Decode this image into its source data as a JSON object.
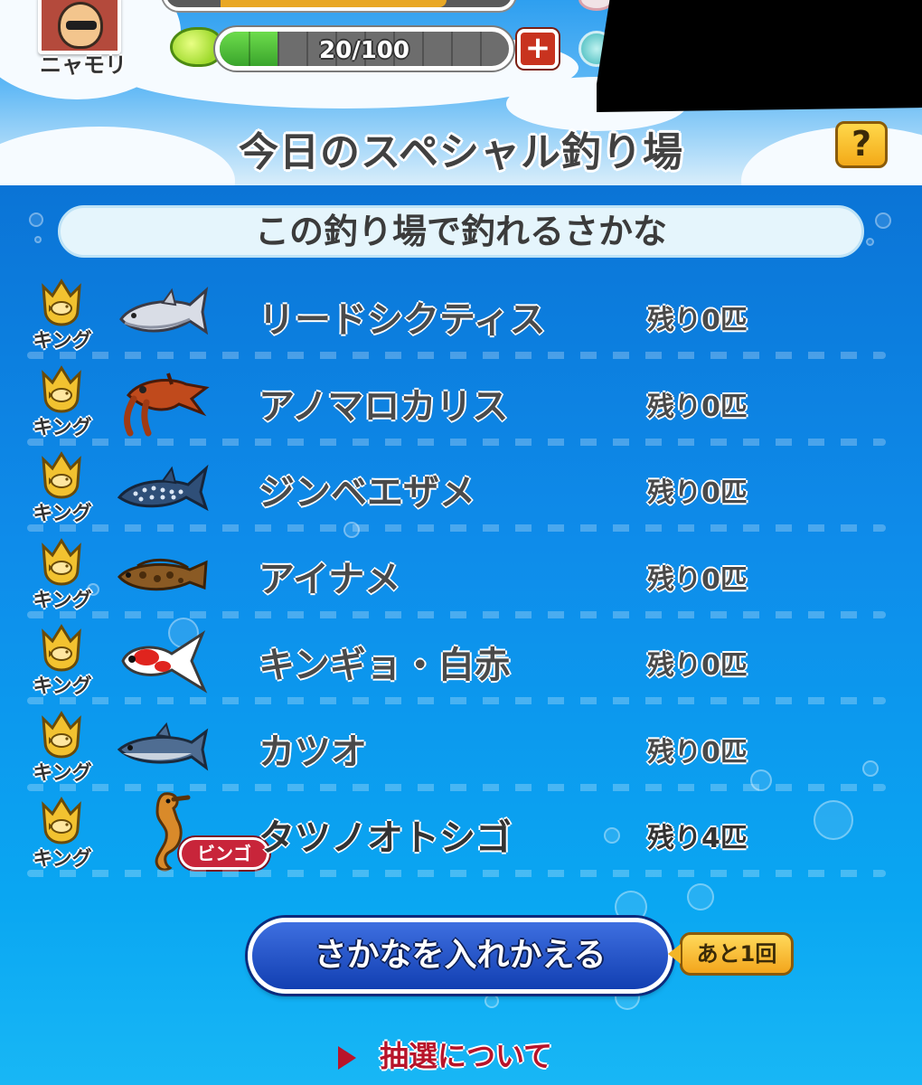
{
  "player": {
    "name": "ニャモリ"
  },
  "stamina": {
    "value": 20,
    "max": 100,
    "label": "20/100"
  },
  "page_title": "今日のスペシャル釣り場",
  "help_label": "?",
  "section_header": "この釣り場で釣れるさかな",
  "fish": [
    {
      "name": "リードシクティス",
      "remaining": "残り0匹",
      "badge": "キング",
      "icon": "leedsichthys-icon",
      "bingo": false
    },
    {
      "name": "アノマロカリス",
      "remaining": "残り0匹",
      "badge": "キング",
      "icon": "anomalocaris-icon",
      "bingo": false
    },
    {
      "name": "ジンベエザメ",
      "remaining": "残り0匹",
      "badge": "キング",
      "icon": "whale-shark-icon",
      "bingo": false
    },
    {
      "name": "アイナメ",
      "remaining": "残り0匹",
      "badge": "キング",
      "icon": "greenling-icon",
      "bingo": false
    },
    {
      "name": "キンギョ・白赤",
      "remaining": "残り0匹",
      "badge": "キング",
      "icon": "goldfish-icon",
      "bingo": false
    },
    {
      "name": "カツオ",
      "remaining": "残り0匹",
      "badge": "キング",
      "icon": "bonito-icon",
      "bingo": false
    },
    {
      "name": "タツノオトシゴ",
      "remaining": "残り4匹",
      "badge": "キング",
      "icon": "seahorse-icon",
      "bingo": true
    }
  ],
  "bingo_label": "ビンゴ",
  "swap_button_label": "さかなを入れかえる",
  "swap_remaining_label": "あと1回",
  "lottery_link_label": "抽選について",
  "colors": {
    "water": "#0a8fe3",
    "crown_gold": "#f2c230",
    "bingo_red": "#c8253a",
    "swap_blue": "#1d4fc4",
    "link_red": "#b8142a"
  }
}
